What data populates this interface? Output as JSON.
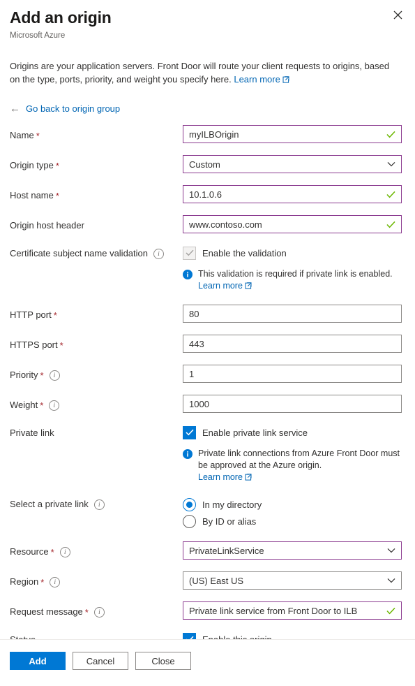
{
  "header": {
    "title": "Add an origin",
    "subtitle": "Microsoft Azure",
    "close_icon": "close-icon"
  },
  "intro": {
    "text": "Origins are your application servers. Front Door will route your client requests to origins, based on the type, ports, priority, and weight you specify here.",
    "learn_more": "Learn more"
  },
  "back_link": {
    "arrow": "←",
    "label": "Go back to origin group"
  },
  "form": {
    "name": {
      "label": "Name",
      "required": "*",
      "value": "myILBOrigin"
    },
    "origin_type": {
      "label": "Origin type",
      "required": "*",
      "value": "Custom"
    },
    "host_name": {
      "label": "Host name",
      "required": "*",
      "value": "10.1.0.6"
    },
    "origin_host_header": {
      "label": "Origin host header",
      "value": "www.contoso.com"
    },
    "cert_validation": {
      "label": "Certificate subject name validation",
      "checkbox_label": "Enable the validation",
      "checked": true,
      "disabled": true,
      "info": {
        "text": "This validation is required if private link is enabled.",
        "learn_more": "Learn more"
      }
    },
    "http_port": {
      "label": "HTTP port",
      "required": "*",
      "value": "80"
    },
    "https_port": {
      "label": "HTTPS port",
      "required": "*",
      "value": "443"
    },
    "priority": {
      "label": "Priority",
      "required": "*",
      "value": "1"
    },
    "weight": {
      "label": "Weight",
      "required": "*",
      "value": "1000"
    },
    "private_link": {
      "label": "Private link",
      "checkbox_label": "Enable private link service",
      "checked": true,
      "info": {
        "text": "Private link connections from Azure Front Door must be approved at the Azure origin.",
        "learn_more": "Learn more"
      }
    },
    "select_private_link": {
      "label": "Select a private link",
      "options": [
        {
          "label": "In my directory",
          "selected": true
        },
        {
          "label": "By ID or alias",
          "selected": false
        }
      ]
    },
    "resource": {
      "label": "Resource",
      "required": "*",
      "value": "PrivateLinkService"
    },
    "region": {
      "label": "Region",
      "required": "*",
      "value": "(US) East US"
    },
    "request_message": {
      "label": "Request message",
      "required": "*",
      "value": "Private link service from Front Door to ILB"
    },
    "status": {
      "label": "Status",
      "checkbox_label": "Enable this origin",
      "checked": true
    }
  },
  "footer": {
    "add_label": "Add",
    "cancel_label": "Cancel",
    "close_label": "Close"
  },
  "colors": {
    "primary": "#0078d4",
    "validated_border": "#8a3a8f",
    "success": "#6bb700",
    "required": "#a4262c",
    "link": "#0065b3"
  }
}
